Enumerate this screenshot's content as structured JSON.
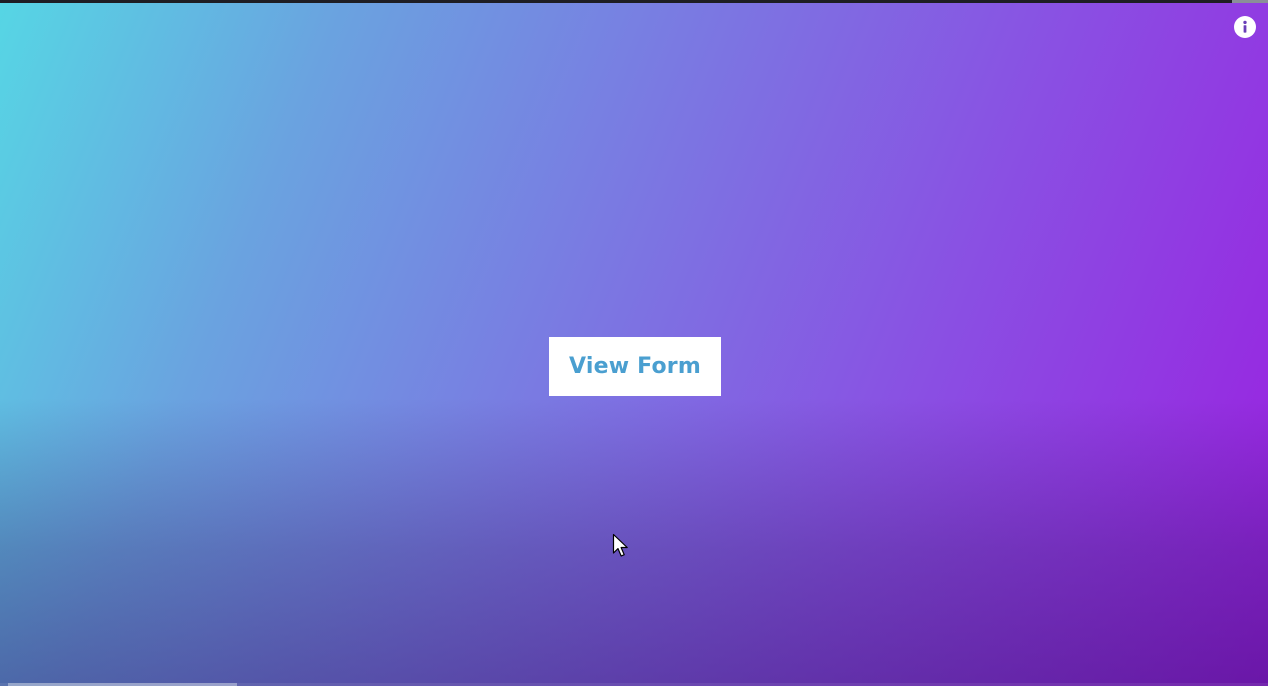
{
  "main": {
    "view_form_button": {
      "label": "View Form"
    }
  },
  "icons": {
    "info": "info-icon",
    "cursor": "mouse-pointer-icon"
  },
  "colors": {
    "gradient_start": "#56d6e4",
    "gradient_mid": "#7a7ae2",
    "gradient_end": "#9a1fe0",
    "button_text": "#4a9fd0",
    "button_background": "#ffffff"
  }
}
